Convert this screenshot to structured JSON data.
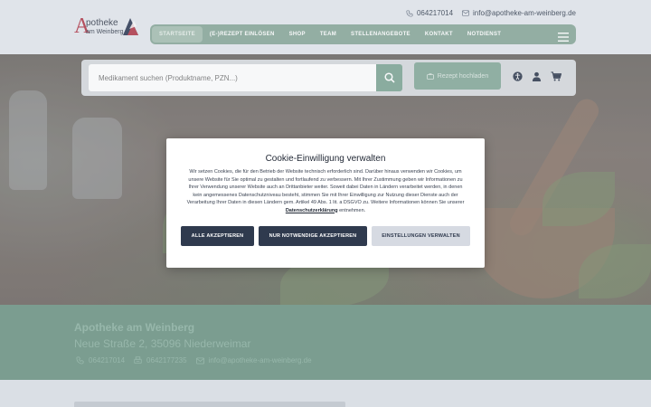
{
  "header": {
    "logo": {
      "line1": "potheke",
      "line2": "am Weinberg",
      "letter": "A"
    },
    "phone": "064217014",
    "email": "info@apotheke-am-weinberg.de"
  },
  "nav": {
    "items": [
      {
        "label": "STARTSEITE",
        "active": true
      },
      {
        "label": "(E-)REZEPT EINLÖSEN"
      },
      {
        "label": "SHOP"
      },
      {
        "label": "TEAM"
      },
      {
        "label": "STELLENANGEBOTE"
      },
      {
        "label": "KONTAKT"
      },
      {
        "label": "NOTDIENST"
      }
    ],
    "menu_icon": "hamburger-menu-icon"
  },
  "search": {
    "placeholder": "Medikament suchen (Produktname, PZN...)",
    "button_icon": "search-icon",
    "upload_label": "Rezept hochladen",
    "upload_icon": "prescription-icon"
  },
  "header_icons": [
    "accessibility-icon",
    "user-icon",
    "cart-icon"
  ],
  "info": {
    "name": "Apotheke am Weinberg",
    "address": "Neue Straße 2, 35096 Niederweimar",
    "phone": "064217014",
    "fax": "0642177235",
    "email": "info@apotheke-am-weinberg.de"
  },
  "cookie_modal": {
    "title": "Cookie-Einwilligung verwalten",
    "text": "Wir setzen Cookies, die für den Betrieb der Website technisch erforderlich sind. Darüber hinaus verwenden wir Cookies, um unsere Website für Sie optimal zu gestalten und fortlaufend zu verbessern. Mit Ihrer Zustimmung geben wir Informationen zu Ihrer Verwendung unserer Website auch an Drittanbieter weiter. Soweit dabei Daten in Ländern verarbeitet werden, in denen kein angemessenes Datenschutzniveau besteht, stimmen Sie mit Ihrer Einwilligung zur Nutzung dieser Dienste auch der Verarbeitung Ihrer Daten in diesen Ländern gem. Artikel 49 Abs. 1 lit. a DSGVO zu. Weitere Informationen können Sie unserer",
    "link": "Datenschutzerklärung",
    "text_end": "entnehmen.",
    "buttons": {
      "accept_all": "ALLE AKZEPTIEREN",
      "necessary_only": "NUR NOTWENDIGE AKZEPTIEREN",
      "settings": "EINSTELLUNGEN VERWALTEN"
    }
  },
  "colors": {
    "nav_green": "#8aa99a",
    "info_green": "#6e9584",
    "button_dark": "#2f3a4e",
    "button_light": "#d6dae2"
  }
}
